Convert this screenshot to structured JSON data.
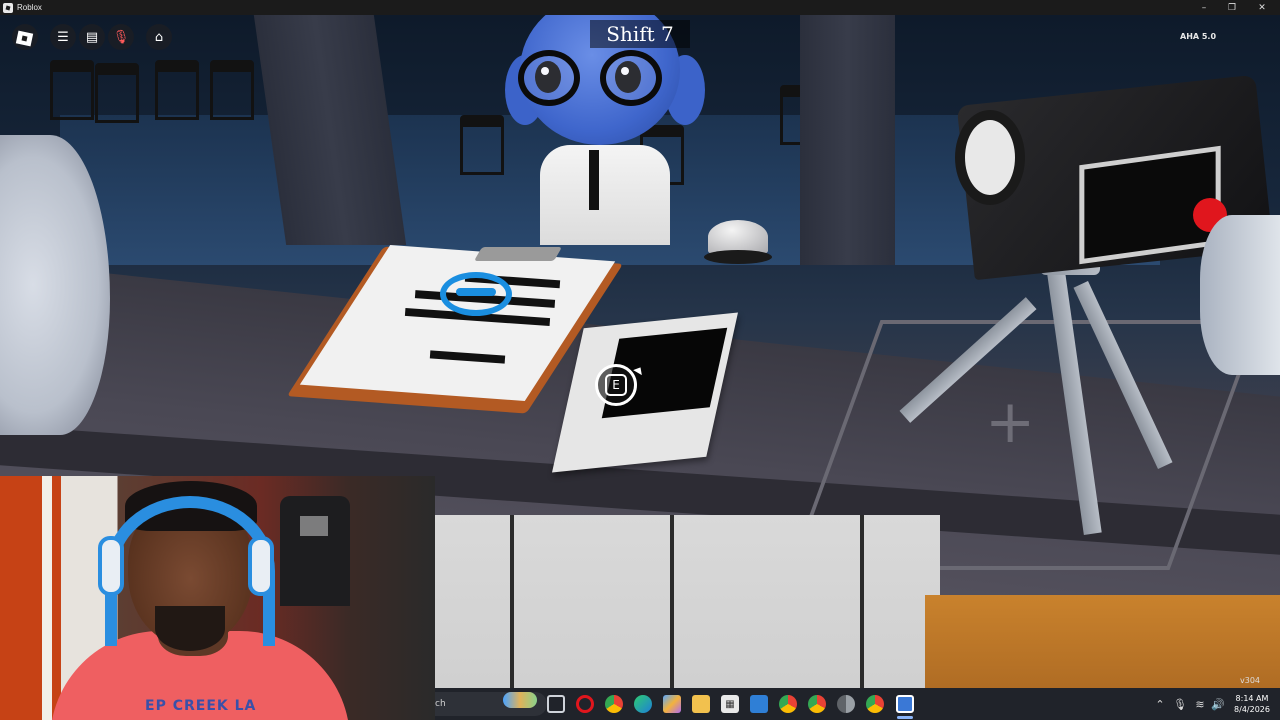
{
  "window": {
    "title": "Roblox",
    "controls": {
      "minimize": "–",
      "maximize": "❐",
      "close": "✕"
    }
  },
  "hud": {
    "shift_label": "Shift 7",
    "fps_label": "AHA 5.0",
    "version": "v304",
    "interact_key": "E",
    "buttons": [
      {
        "name": "roblox-menu",
        "icon": "roblox-logo-icon"
      },
      {
        "name": "hamburger-menu",
        "icon": "menu-icon"
      },
      {
        "name": "chat",
        "icon": "chat-icon"
      },
      {
        "name": "microphone",
        "icon": "mic-muted-icon"
      },
      {
        "name": "backpack",
        "icon": "backpack-icon"
      }
    ]
  },
  "webcam": {
    "shirt_text": "EP CREEK LA"
  },
  "taskbar": {
    "search_text": "ch",
    "icons": [
      "task-view-icon",
      "opera-icon",
      "chrome-icon",
      "edge-icon",
      "copilot-icon",
      "file-explorer-icon",
      "store-icon",
      "photos-icon",
      "chrome-icon",
      "chrome-icon",
      "chrome-icon",
      "chrome-icon",
      "roblox-icon"
    ],
    "clock_time": "8:14 AM",
    "clock_date": "8/4/2026"
  },
  "colors": {
    "accent_blue": "#1a8ee0",
    "record_red": "#e0161d",
    "taskbar_bg": "#20232a"
  }
}
